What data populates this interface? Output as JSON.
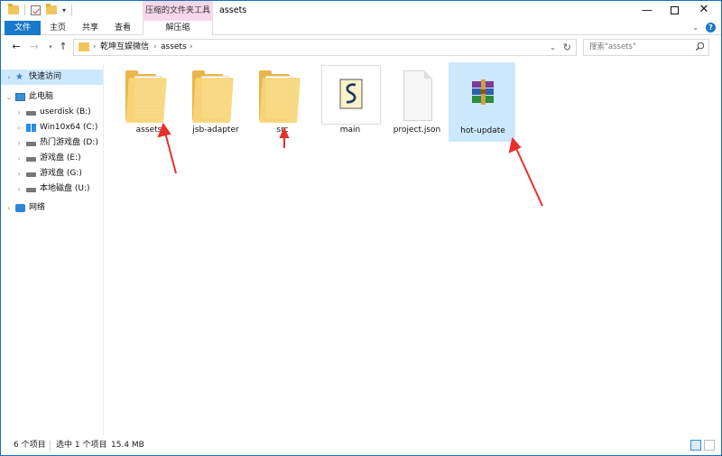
{
  "window": {
    "title": "assets",
    "context_tab_group": "压缩的文件夹工具",
    "controls": {
      "minimize": "—",
      "restore": "",
      "close": "✕"
    }
  },
  "ribbon": {
    "tabs": [
      "文件",
      "主页",
      "共享",
      "查看",
      "解压缩"
    ]
  },
  "address": {
    "crumbs": [
      "乾坤互娱微信",
      "assets"
    ],
    "search_placeholder": "搜索\"assets\""
  },
  "sidebar": {
    "items": [
      {
        "label": "快速访问",
        "icon": "star-icon"
      },
      {
        "label": "此电脑",
        "icon": "computer-icon"
      },
      {
        "label": "userdisk (B:)",
        "icon": "drive-icon"
      },
      {
        "label": "Win10x64 (C:)",
        "icon": "windows-drive-icon"
      },
      {
        "label": "热门游戏盘 (D:)",
        "icon": "drive-icon"
      },
      {
        "label": "游戏盘 (E:)",
        "icon": "drive-icon"
      },
      {
        "label": "游戏盘 (G:)",
        "icon": "drive-icon"
      },
      {
        "label": "本地磁盘 (U:)",
        "icon": "drive-icon"
      },
      {
        "label": "网络",
        "icon": "network-icon"
      }
    ]
  },
  "files": [
    {
      "name": "assets",
      "kind": "folder"
    },
    {
      "name": "jsb-adapter",
      "kind": "folder"
    },
    {
      "name": "src",
      "kind": "folder"
    },
    {
      "name": "main",
      "kind": "script"
    },
    {
      "name": "project.json",
      "kind": "document"
    },
    {
      "name": "hot-update",
      "kind": "archive",
      "selected": true
    }
  ],
  "status": {
    "count": "6 个项目",
    "selection": "选中 1 个项目",
    "size": "15.4 MB"
  },
  "colors": {
    "accent": "#1979ca",
    "selection": "#cce8ff",
    "context_tab": "#f7d8ea",
    "annotation_arrow": "#e8302a"
  }
}
